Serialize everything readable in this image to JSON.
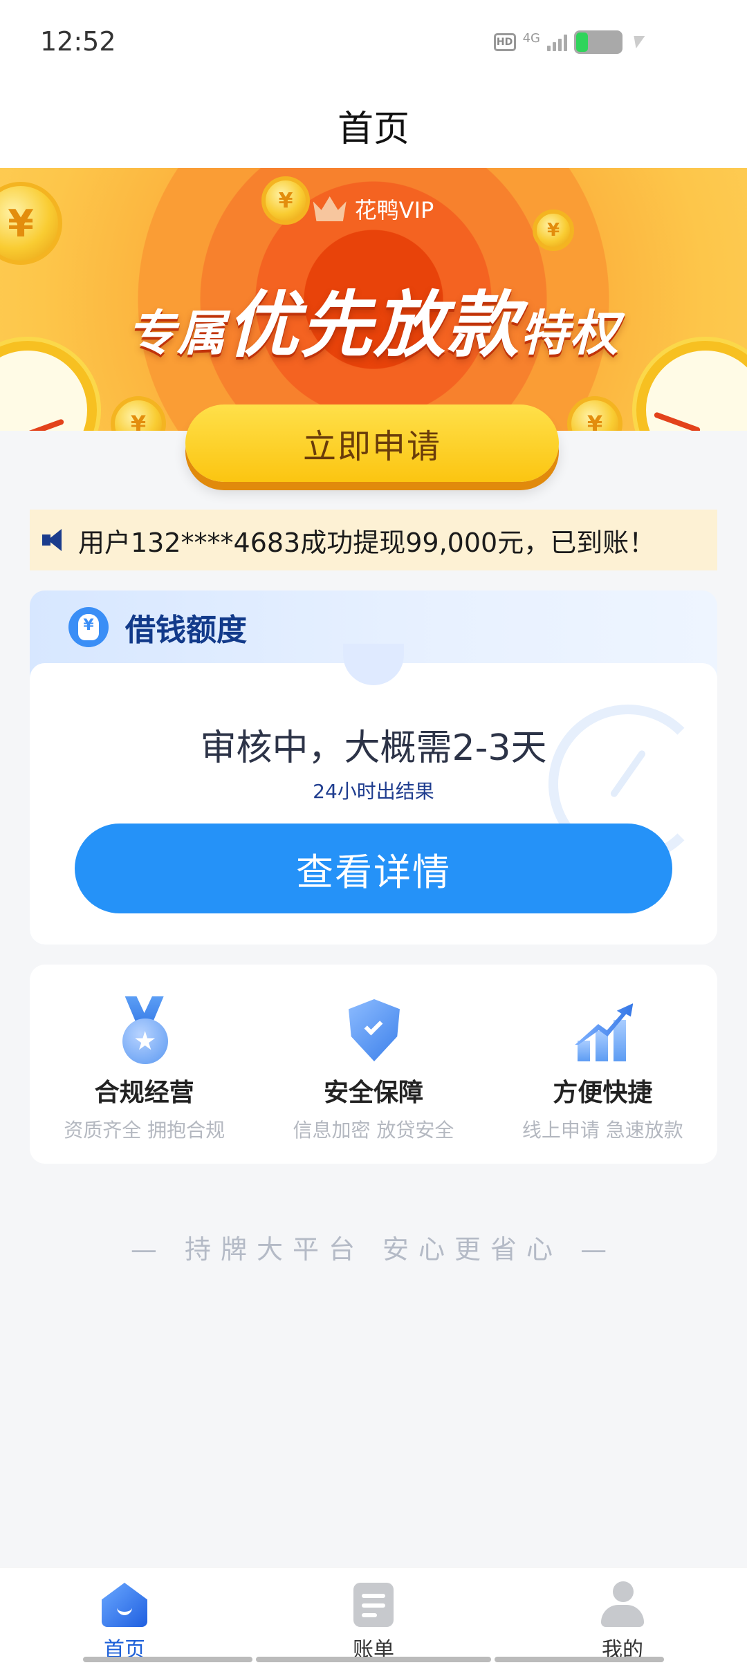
{
  "status_bar": {
    "time": "12:52",
    "hd_badge": "HD",
    "network": "4G",
    "battery_level": 0.2,
    "charging": true
  },
  "header": {
    "title": "首页"
  },
  "banner": {
    "vip_label": "花鸭VIP",
    "headline_part1": "专属",
    "headline_part2": "优先放款",
    "headline_part3": "特权",
    "apply_button": "立即申请",
    "colors": {
      "center": "#e8430a",
      "outer": "#fed05a",
      "button": "#fbc511"
    }
  },
  "notice": {
    "text": "用户132****4683成功提现99,000元，已到账！"
  },
  "quota_card": {
    "title": "借钱额度",
    "status": "审核中，大概需2-3天",
    "subtitle": "24小时出结果",
    "button": "查看详情",
    "accent": "#2592f8"
  },
  "features": [
    {
      "title": "合规经营",
      "desc": "资质齐全 拥抱合规",
      "icon": "medal-icon"
    },
    {
      "title": "安全保障",
      "desc": "信息加密 放贷安全",
      "icon": "shield-icon"
    },
    {
      "title": "方便快捷",
      "desc": "线上申请 急速放款",
      "icon": "growth-chart-icon"
    }
  ],
  "slogan": "— 持牌大平台 安心更省心 —",
  "bottom_nav": [
    {
      "label": "首页",
      "icon": "home-icon",
      "active": true
    },
    {
      "label": "账单",
      "icon": "bill-icon",
      "active": false
    },
    {
      "label": "我的",
      "icon": "profile-icon",
      "active": false
    }
  ]
}
